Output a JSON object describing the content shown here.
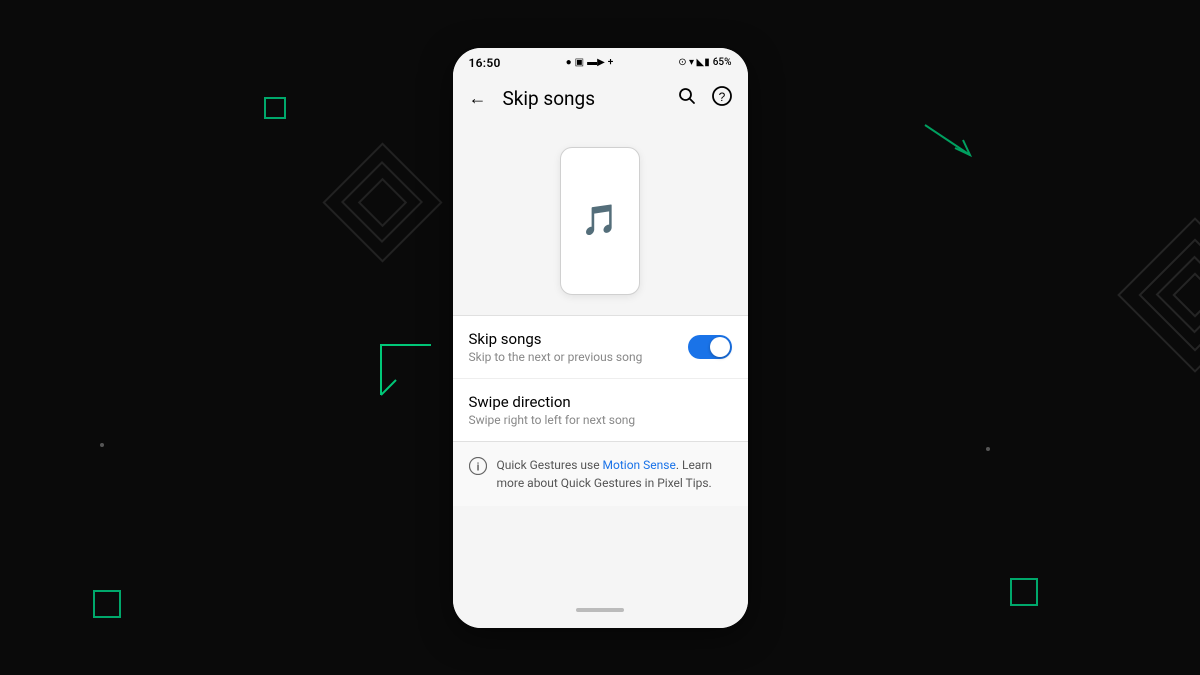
{
  "background": "#0a0a0a",
  "status_bar": {
    "time": "16:50",
    "battery": "65%",
    "icons": [
      "●",
      "▣",
      "▬",
      "▶",
      "+"
    ]
  },
  "header": {
    "title": "Skip songs",
    "back_label": "←",
    "search_label": "🔍",
    "help_label": "?"
  },
  "illustration": {
    "alt": "Phone with music note"
  },
  "settings": [
    {
      "id": "skip-songs",
      "title": "Skip songs",
      "subtitle": "Skip to the next or previous song",
      "toggle": true,
      "toggle_state": true
    },
    {
      "id": "swipe-direction",
      "title": "Swipe direction",
      "subtitle": "Swipe right to left for next song",
      "toggle": false
    }
  ],
  "info": {
    "icon": "ℹ",
    "text_before_link": "Quick Gestures use ",
    "link_text": "Motion Sense",
    "text_after_link": ". Learn more about Quick Gestures in Pixel Tips."
  },
  "home_indicator": true
}
